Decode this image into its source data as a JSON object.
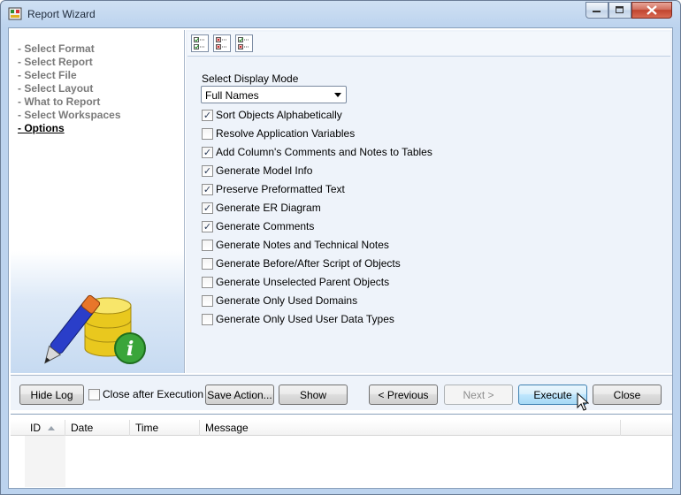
{
  "window": {
    "title": "Report Wizard"
  },
  "steps": [
    {
      "label": "- Select Format",
      "active": false
    },
    {
      "label": "- Select Report",
      "active": false
    },
    {
      "label": "- Select File",
      "active": false
    },
    {
      "label": "- Select Layout",
      "active": false
    },
    {
      "label": "- What to Report",
      "active": false
    },
    {
      "label": "- Select Workspaces",
      "active": false
    },
    {
      "label": "- Options",
      "active": true
    }
  ],
  "toolbar": {
    "icons": [
      "check-all-icon",
      "uncheck-all-icon",
      "invert-check-icon"
    ]
  },
  "display_mode": {
    "label": "Select Display Mode",
    "selected": "Full Names"
  },
  "options": [
    {
      "label": "Sort Objects Alphabetically",
      "checked": true
    },
    {
      "label": "Resolve Application Variables",
      "checked": false
    },
    {
      "label": "Add Column's Comments and Notes to Tables",
      "checked": true
    },
    {
      "label": "Generate Model Info",
      "checked": true
    },
    {
      "label": "Preserve Preformatted Text",
      "checked": true
    },
    {
      "label": "Generate ER Diagram",
      "checked": true
    },
    {
      "label": "Generate Comments",
      "checked": true
    },
    {
      "label": "Generate Notes and Technical Notes",
      "checked": false
    },
    {
      "label": "Generate Before/After Script of Objects",
      "checked": false
    },
    {
      "label": "Generate Unselected Parent Objects",
      "checked": false
    },
    {
      "label": "Generate Only Used Domains",
      "checked": false
    },
    {
      "label": "Generate Only Used User Data Types",
      "checked": false
    }
  ],
  "buttons": {
    "hide_log": "Hide Log",
    "close_after_execution": "Close after Execution",
    "close_after_execution_checked": false,
    "save_action": "Save Action...",
    "show": "Show",
    "previous": "< Previous",
    "next": "Next >",
    "execute": "Execute",
    "close": "Close"
  },
  "log": {
    "columns": [
      "ID",
      "Date",
      "Time",
      "Message"
    ]
  }
}
